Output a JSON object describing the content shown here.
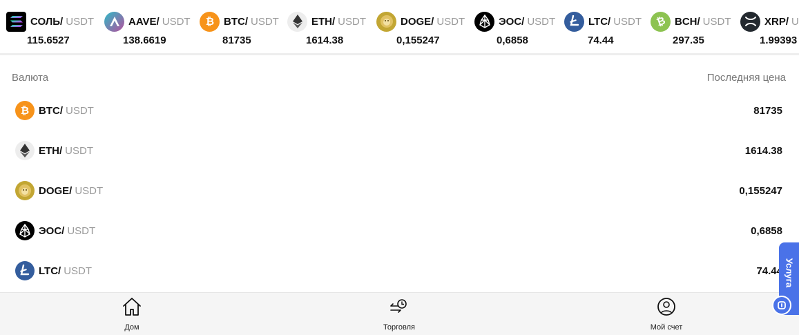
{
  "ticker": [
    {
      "symbol": "СОЛЬ/",
      "quote": "USDT",
      "price": "115.6527",
      "icon": "solana-icon"
    },
    {
      "symbol": "AAVE/",
      "quote": "USDT",
      "price": "138.6619",
      "icon": "aave-icon"
    },
    {
      "symbol": "BTC/",
      "quote": "USDT",
      "price": "81735",
      "icon": "bitcoin-icon"
    },
    {
      "symbol": "ETH/",
      "quote": "USDT",
      "price": "1614.38",
      "icon": "ethereum-icon"
    },
    {
      "symbol": "DOGE/",
      "quote": "USDT",
      "price": "0,155247",
      "icon": "dogecoin-icon"
    },
    {
      "symbol": "ЭОС/",
      "quote": "USDT",
      "price": "0,6858",
      "icon": "eos-icon"
    },
    {
      "symbol": "LTC/",
      "quote": "USDT",
      "price": "74.44",
      "icon": "litecoin-icon"
    },
    {
      "symbol": "BCH/",
      "quote": "USDT",
      "price": "297.35",
      "icon": "bitcoin-cash-icon"
    },
    {
      "symbol": "XRP/",
      "quote": "USDT",
      "price": "1.99393",
      "icon": "xrp-icon"
    }
  ],
  "table": {
    "col_currency": "Валюта",
    "col_last_price": "Последняя цена",
    "rows": [
      {
        "symbol": "BTC/",
        "quote": "USDT",
        "price": "81735",
        "icon": "bitcoin-icon"
      },
      {
        "symbol": "ETH/",
        "quote": "USDT",
        "price": "1614.38",
        "icon": "ethereum-icon"
      },
      {
        "symbol": "DOGE/",
        "quote": "USDT",
        "price": "0,155247",
        "icon": "dogecoin-icon"
      },
      {
        "symbol": "ЭОС/",
        "quote": "USDT",
        "price": "0,6858",
        "icon": "eos-icon"
      },
      {
        "symbol": "LTC/",
        "quote": "USDT",
        "price": "74.44",
        "icon": "litecoin-icon"
      }
    ]
  },
  "nav": {
    "home": "Дом",
    "trade": "Торговля",
    "account": "Мой счет"
  },
  "service": {
    "label": "Услуга"
  },
  "colors": {
    "bitcoin": "#f7931a",
    "ethereum_bg": "#ededed",
    "dogecoin": "#c2a633",
    "eos": "#000000",
    "litecoin": "#345d9d",
    "bitcoin_cash": "#8dc351",
    "xrp": "#23292f",
    "service_tab": "#4a72e8",
    "quote_text": "#9a9a9a"
  }
}
